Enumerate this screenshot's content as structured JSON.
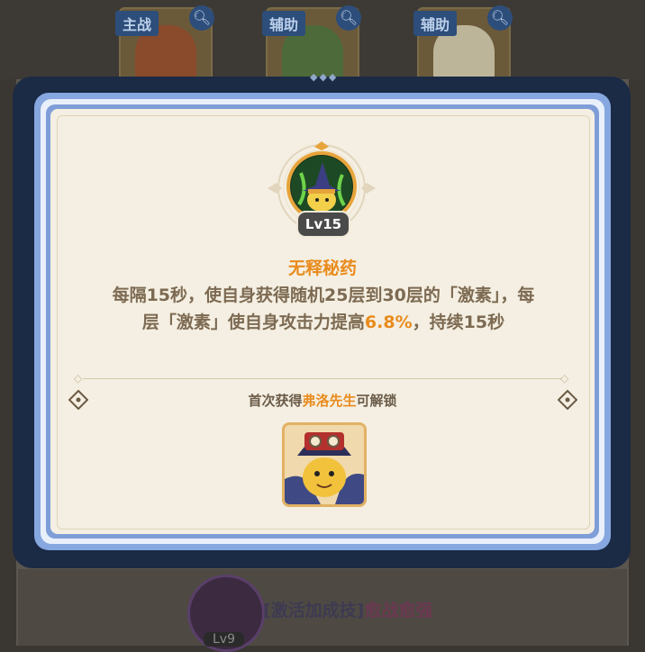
{
  "team_slots": [
    {
      "tag": "主战",
      "color": "#9b4a2a"
    },
    {
      "tag": "辅助",
      "color": "#4d6a3a"
    },
    {
      "tag": "辅助",
      "color": "#c9c1a4"
    }
  ],
  "skill": {
    "level": "Lv15",
    "name": "无释秘药",
    "desc_line1_a": "每隔15秒，使自身获得随机25层到30层的「激素」，每",
    "desc_line2_a": "层「激素」使自身攻击力提高",
    "desc_value": "6.8%",
    "desc_line2_b": "，持续15秒"
  },
  "unlock": {
    "prefix": "首次获得",
    "hero_name": "弗洛先生",
    "suffix": "可解锁"
  },
  "background": {
    "bonus_skill_prefix": "[激活加成技]",
    "bonus_skill_name": "愈战愈强",
    "level_partial": "Lv9"
  },
  "colors": {
    "accent_orange": "#e98b1d",
    "frame_blue": "#86a7df",
    "card_bg": "#f4efe2"
  }
}
